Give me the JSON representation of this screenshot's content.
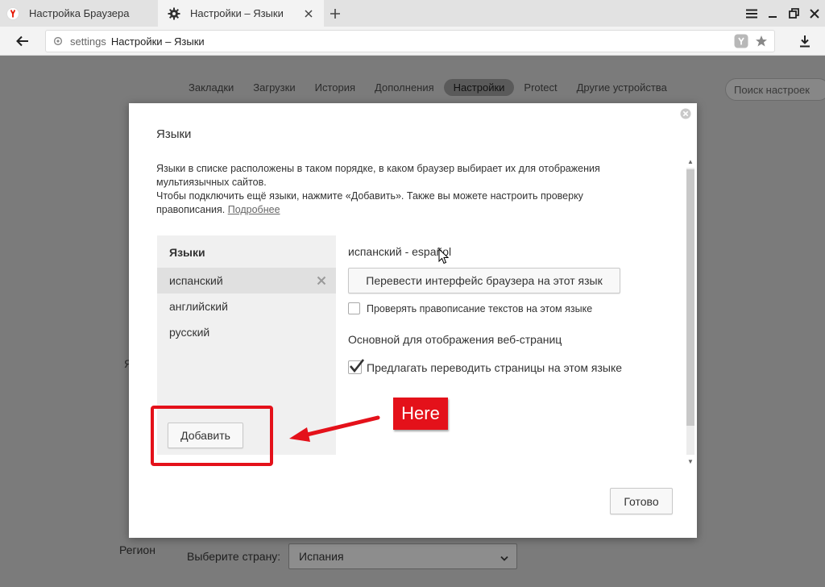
{
  "tabs": [
    {
      "label": "Настройка Браузера",
      "icon": "yandex-logo-icon",
      "active": false
    },
    {
      "label": "Настройки – Языки",
      "icon": "gear-icon",
      "active": true
    }
  ],
  "address": {
    "scheme": "settings",
    "title": "Настройки – Языки"
  },
  "nav": {
    "items": [
      "Закладки",
      "Загрузки",
      "История",
      "Дополнения",
      "Настройки",
      "Protect",
      "Другие устройства"
    ],
    "active_index": 4,
    "search_placeholder": "Поиск настроек"
  },
  "background": {
    "section_letter": "Я",
    "region_label": "Регион",
    "country_label": "Выберите страну:",
    "country_value": "Испания"
  },
  "dialog": {
    "title": "Языки",
    "description_line1": "Языки в списке расположены в таком порядке, в каком браузер выбирает их для отображения мультиязычных сайтов.",
    "description_line2": "Чтобы подключить ещё языки, нажмите «Добавить». Также вы можете настроить проверку правописания.",
    "more_link": "Подробнее",
    "list_header": "Языки",
    "languages": [
      "испанский",
      "английский",
      "русский"
    ],
    "selected_index": 0,
    "add_button": "Добавить",
    "selected_detail": {
      "name": "испанский - español",
      "translate_ui_button": "Перевести интерфейс браузера на этот язык",
      "spellcheck_label": "Проверять правописание текстов на этом языке",
      "spellcheck_checked": false,
      "primary_label": "Основной для отображения веб-страниц",
      "offer_translate_label": "Предлагать переводить страницы на этом языке",
      "offer_translate_checked": true
    },
    "done_button": "Готово"
  },
  "annotation": {
    "label": "Here",
    "color": "#e4111a"
  },
  "colors": {
    "accent_red": "#e4111a",
    "yandex_red": "#e61400",
    "overlay": "#7b7b7b"
  }
}
